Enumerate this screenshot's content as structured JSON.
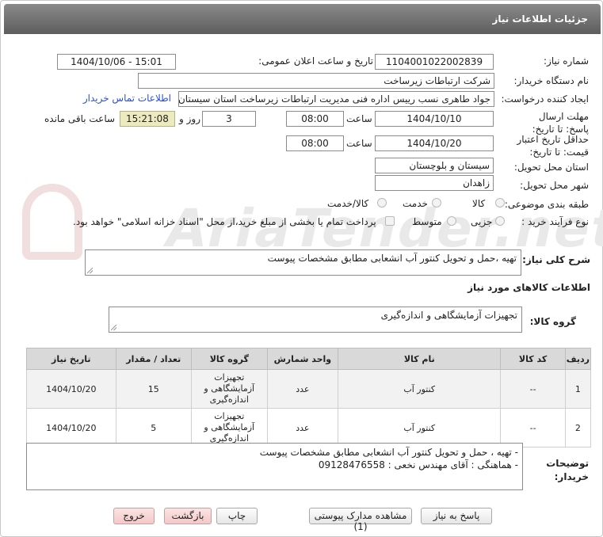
{
  "header": {
    "title": "جزئیات اطلاعات نیاز"
  },
  "watermark": {
    "text": "AriaTender.net"
  },
  "form": {
    "need_number_label": "شماره نیاز:",
    "need_number": "1104001022002839",
    "announce_label": "تاریخ و ساعت اعلان عمومی:",
    "announce_value": "1404/10/06 - 15:01",
    "buyer_org_label": "نام دستگاه خریدار:",
    "buyer_org": "شرکت ارتباطات زیرساخت",
    "requester_label": "ایجاد کننده درخواست:",
    "requester": "جواد طاهری نسب رییس اداره فنی مدیریت ارتباطات زیرساخت استان سیستان و",
    "contact_link": "اطلاعات تماس خریدار",
    "reply_deadline_label": "مهلت ارسال پاسخ: تا تاریخ:",
    "reply_date": "1404/10/10",
    "time_label": "ساعت",
    "reply_time": "08:00",
    "days_value": "3",
    "days_label": "روز و",
    "remaining_time": "15:21:08",
    "remaining_label": "ساعت باقی مانده",
    "validity_label": "حداقل تاریخ اعتبار قیمت: تا تاریخ:",
    "validity_date": "1404/10/20",
    "validity_time": "08:00",
    "province_label": "استان محل تحویل:",
    "province": "سیستان و بلوچستان",
    "city_label": "شهر محل تحویل:",
    "city": "زاهدان",
    "category_label": "طبقه بندی موضوعی:",
    "category_options": [
      "کالا",
      "خدمت",
      "کالا/خدمت"
    ],
    "process_label": "نوع فرآیند خرید :",
    "process_options": [
      "جزیی",
      "متوسط"
    ],
    "payment_note": "پرداخت تمام یا بخشی از مبلغ خرید،از محل \"اسناد خزانه اسلامی\" خواهد بود.",
    "description_label": "شرح کلی نیاز:",
    "description": "تهیه ،حمل و تحویل کنتور آب انشعابی مطابق مشخصات پیوست",
    "goods_info_title": "اطلاعات کالاهای مورد نیاز",
    "goods_group_label": "گروه کالا:",
    "goods_group": "تجهیزات آزمایشگاهی و اندازه‌گیری"
  },
  "table": {
    "headers": [
      "ردیف",
      "کد کالا",
      "نام کالا",
      "واحد شمارش",
      "گروه کالا",
      "تعداد / مقدار",
      "تاریخ نیاز"
    ],
    "rows": [
      [
        "1",
        "--",
        "کنتور آب",
        "عدد",
        "تجهیزات آزمایشگاهی و اندازه‌گیری",
        "15",
        "1404/10/20"
      ],
      [
        "2",
        "--",
        "کنتور آب",
        "عدد",
        "تجهیزات آزمایشگاهی و اندازه‌گیری",
        "5",
        "1404/10/20"
      ]
    ]
  },
  "buyer_notes": {
    "label": "توضیحات خریدار:",
    "line1": "- تهیه ، حمل و تحویل کنتور آب انشعابی مطابق مشخصات پیوست",
    "line2": "- هماهنگی : آقای مهندس نخعی : 09128476558"
  },
  "buttons": {
    "reply": "پاسخ به نیاز",
    "attachments": "مشاهده مدارک پیوستی (1)",
    "print": "چاپ",
    "back": "بازگشت",
    "exit": "خروج"
  }
}
